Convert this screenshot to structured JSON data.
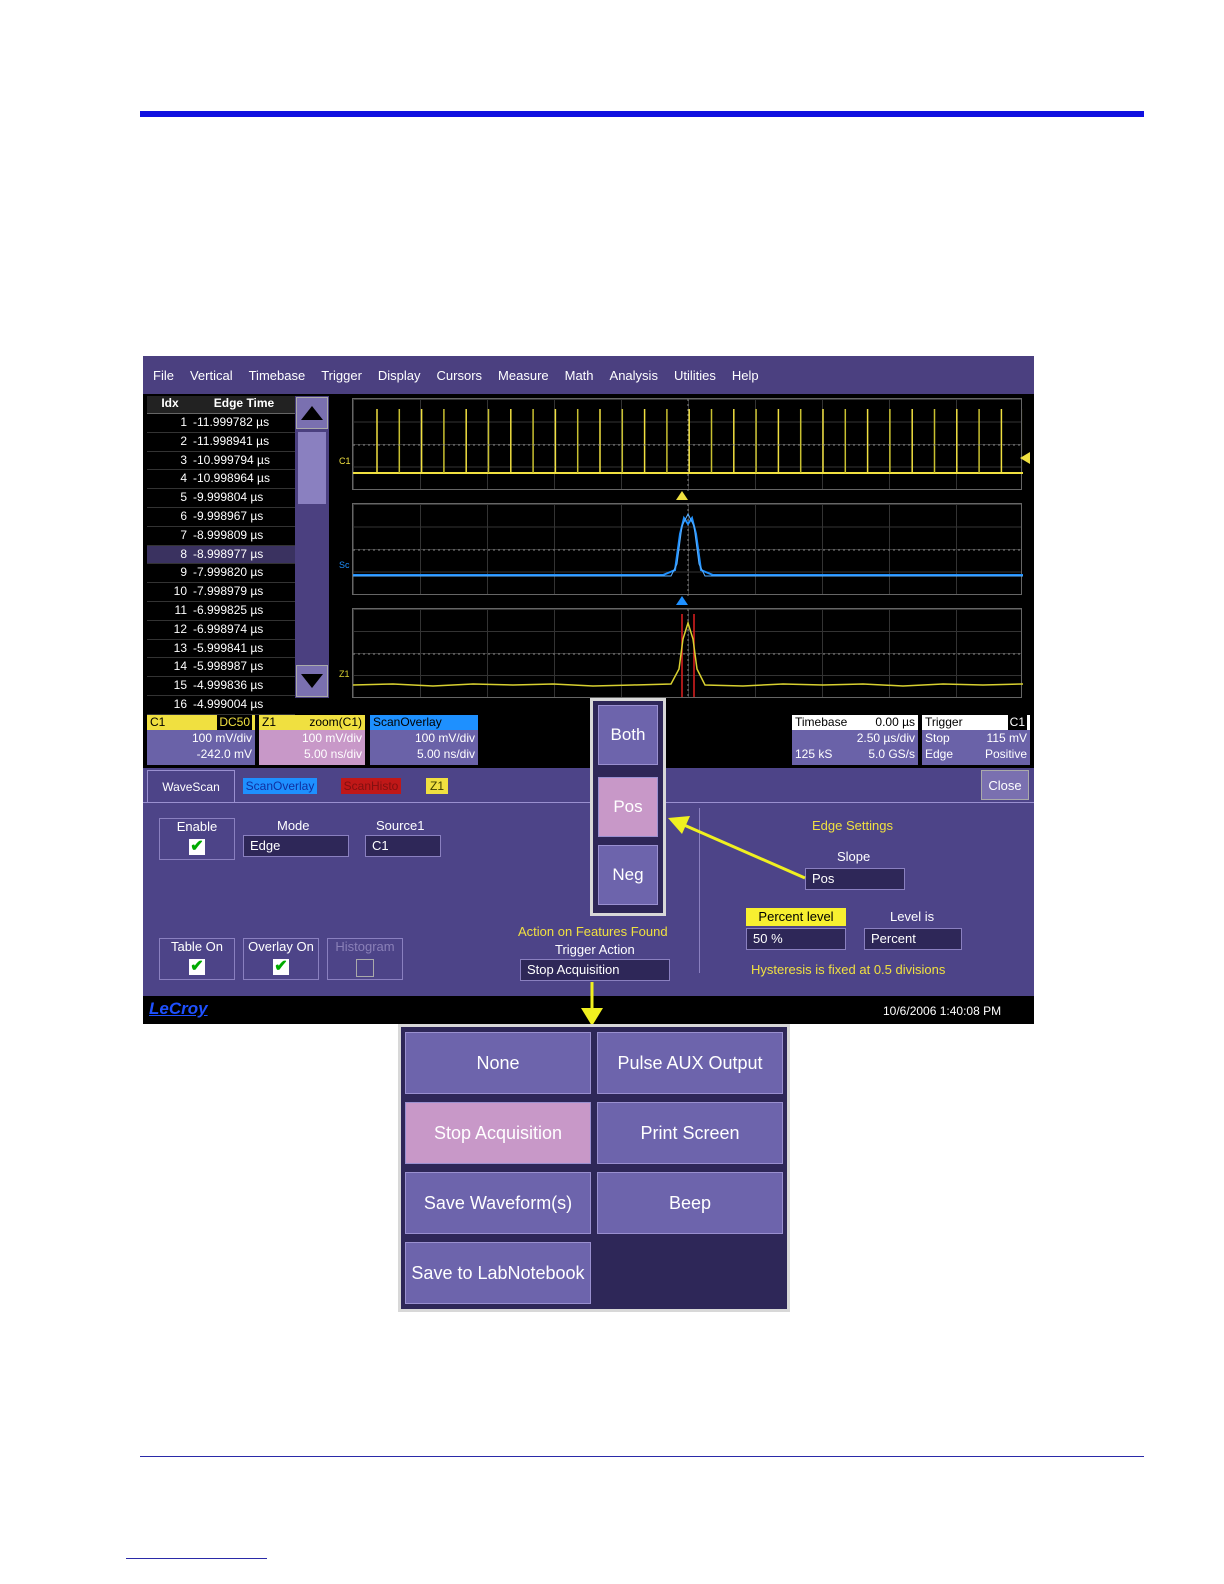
{
  "menu": [
    "File",
    "Vertical",
    "Timebase",
    "Trigger",
    "Display",
    "Cursors",
    "Measure",
    "Math",
    "Analysis",
    "Utilities",
    "Help"
  ],
  "table": {
    "headers": [
      "Idx",
      "Edge Time"
    ],
    "rows": [
      [
        "1",
        "-11.999782 µs"
      ],
      [
        "2",
        "-11.998941 µs"
      ],
      [
        "3",
        "-10.999794 µs"
      ],
      [
        "4",
        "-10.998964 µs"
      ],
      [
        "5",
        "-9.999804 µs"
      ],
      [
        "6",
        "-9.998967 µs"
      ],
      [
        "7",
        "-8.999809 µs"
      ],
      [
        "8",
        "-8.998977 µs"
      ],
      [
        "9",
        "-7.999820 µs"
      ],
      [
        "10",
        "-7.998979 µs"
      ],
      [
        "11",
        "-6.999825 µs"
      ],
      [
        "12",
        "-6.998974 µs"
      ],
      [
        "13",
        "-5.999841 µs"
      ],
      [
        "14",
        "-5.998987 µs"
      ],
      [
        "15",
        "-4.999836 µs"
      ],
      [
        "16",
        "-4.999004 µs"
      ]
    ],
    "selected_index": 8
  },
  "traces": {
    "c1": "C1",
    "sc": "Sc",
    "z1": "Z1"
  },
  "channels": {
    "c1": {
      "name": "C1",
      "badge": "DC50",
      "vdiv": "100 mV/div",
      "offset": "-242.0 mV"
    },
    "z1": {
      "name": "Z1",
      "source": "zoom(C1)",
      "vdiv": "100 mV/div",
      "tdiv": "5.00 ns/div"
    },
    "so": {
      "name": "ScanOverlay",
      "vdiv": "100 mV/div",
      "tdiv": "5.00 ns/div"
    }
  },
  "timebase": {
    "label": "Timebase",
    "delay": "0.00 µs",
    "tdiv": "2.50 µs/div",
    "samples": "125 kS",
    "rate": "5.0 GS/s"
  },
  "trigger": {
    "label": "Trigger",
    "source": "C1",
    "mode": "Stop",
    "level": "115 mV",
    "type": "Edge",
    "slope": "Positive"
  },
  "tabs": [
    "WaveScan",
    "ScanOverlay",
    "ScanHisto",
    "Z1"
  ],
  "close_label": "Close",
  "form": {
    "enable_label": "Enable",
    "mode_label": "Mode",
    "mode_value": "Edge",
    "source_label": "Source1",
    "source_value": "C1",
    "table_on_label": "Table On",
    "overlay_on_label": "Overlay On",
    "histogram_label": "Histogram",
    "action_heading": "Action on Features Found",
    "trigger_action_label": "Trigger Action",
    "trigger_action_value": "Stop Acquisition",
    "edge_settings_label": "Edge Settings",
    "slope_label": "Slope",
    "slope_value": "Pos",
    "percent_level_label": "Percent level",
    "percent_level_value": "50 %",
    "level_is_label": "Level is",
    "level_is_value": "Percent",
    "hysteresis_note": "Hysteresis is fixed at 0.5 divisions"
  },
  "brand": "LeCroy",
  "datetime": "10/6/2006 1:40:08 PM",
  "slope_popup": {
    "options": [
      "Both",
      "Pos",
      "Neg"
    ],
    "selected": "Pos"
  },
  "action_popup": {
    "options": [
      "None",
      "Pulse AUX Output",
      "Stop Acquisition",
      "Print Screen",
      "Save Waveform(s)",
      "Beep",
      "Save to LabNotebook"
    ],
    "selected": "Stop Acquisition"
  },
  "colors": {
    "accent": "#1010e0",
    "c1": "#f0e040",
    "sc": "#1e90ff",
    "z1": "#d8d030",
    "panel": "#4d4488",
    "selected": "#c898c8"
  }
}
